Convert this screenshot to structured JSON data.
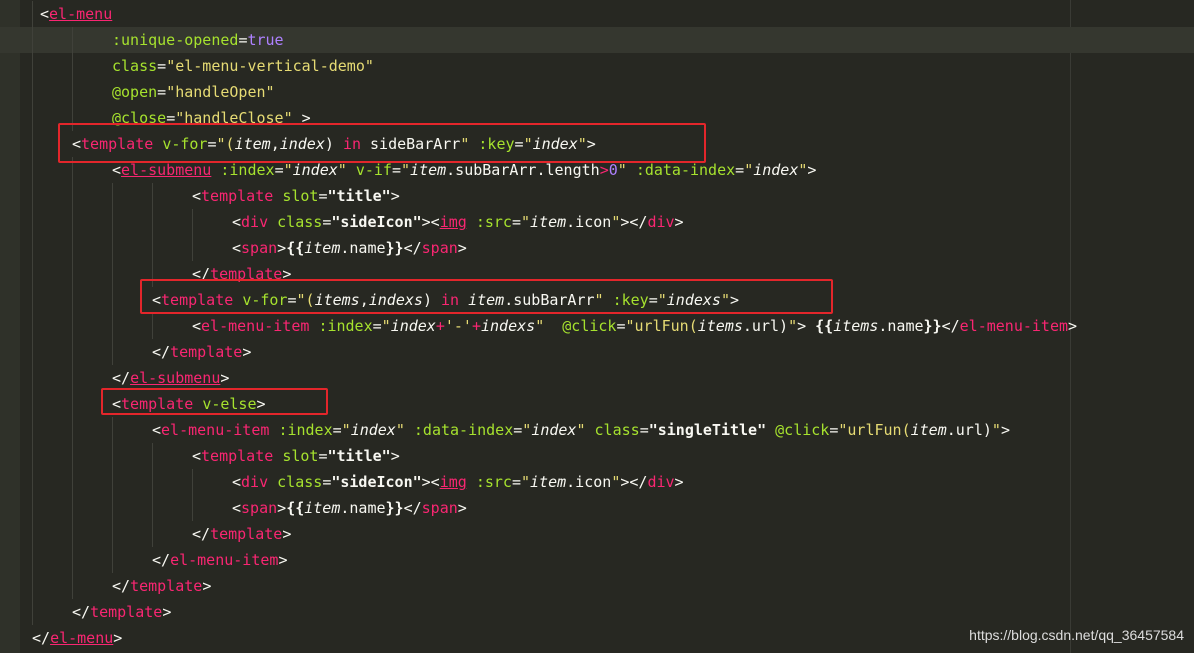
{
  "colors": {
    "background": "#272822",
    "highlight_box": "#e3262b",
    "tag": "#f92672",
    "attribute": "#a6e22e",
    "string": "#e6db74"
  },
  "code_lines": [
    [
      {
        "c": "p",
        "t": "<"
      },
      {
        "c": "t u",
        "t": "el-menu"
      }
    ],
    [
      {
        "c": "a",
        "t": ":unique-opened"
      },
      {
        "c": "p",
        "t": "="
      },
      {
        "c": "n",
        "t": "true"
      }
    ],
    [
      {
        "c": "a",
        "t": "class"
      },
      {
        "c": "p",
        "t": "="
      },
      {
        "c": "s",
        "t": "\"el-menu-vertical-demo\""
      }
    ],
    [
      {
        "c": "a",
        "t": "@open"
      },
      {
        "c": "p",
        "t": "="
      },
      {
        "c": "s",
        "t": "\"handleOpen\""
      }
    ],
    [
      {
        "c": "a",
        "t": "@close"
      },
      {
        "c": "p",
        "t": "="
      },
      {
        "c": "s",
        "t": "\"handleClose\""
      },
      {
        "c": "p",
        "t": " >"
      }
    ],
    [
      {
        "c": "p",
        "t": "<"
      },
      {
        "c": "t",
        "t": "template"
      },
      {
        "c": "p",
        "t": " "
      },
      {
        "c": "a",
        "t": "v-for"
      },
      {
        "c": "p",
        "t": "="
      },
      {
        "c": "s",
        "t": "\"("
      },
      {
        "c": "v",
        "t": "item"
      },
      {
        "c": "p",
        "t": ","
      },
      {
        "c": "v",
        "t": "index"
      },
      {
        "c": "p",
        "t": ") "
      },
      {
        "c": "k",
        "t": "in"
      },
      {
        "c": "p",
        "t": " sideBarArr"
      },
      {
        "c": "s",
        "t": "\""
      },
      {
        "c": "p",
        "t": " "
      },
      {
        "c": "a",
        "t": ":key"
      },
      {
        "c": "p",
        "t": "="
      },
      {
        "c": "s",
        "t": "\""
      },
      {
        "c": "v",
        "t": "index"
      },
      {
        "c": "s",
        "t": "\""
      },
      {
        "c": "p",
        "t": ">"
      }
    ],
    [
      {
        "c": "p",
        "t": "<"
      },
      {
        "c": "t u",
        "t": "el-submenu"
      },
      {
        "c": "p",
        "t": " "
      },
      {
        "c": "a",
        "t": ":index"
      },
      {
        "c": "p",
        "t": "="
      },
      {
        "c": "s",
        "t": "\""
      },
      {
        "c": "v",
        "t": "index"
      },
      {
        "c": "s",
        "t": "\""
      },
      {
        "c": "p",
        "t": " "
      },
      {
        "c": "a",
        "t": "v-if"
      },
      {
        "c": "p",
        "t": "="
      },
      {
        "c": "s",
        "t": "\""
      },
      {
        "c": "v",
        "t": "item"
      },
      {
        "c": "p",
        "t": ".subBarArr.length"
      },
      {
        "c": "k",
        "t": ">"
      },
      {
        "c": "n",
        "t": "0"
      },
      {
        "c": "s",
        "t": "\""
      },
      {
        "c": "p",
        "t": " "
      },
      {
        "c": "a",
        "t": ":data-index"
      },
      {
        "c": "p",
        "t": "="
      },
      {
        "c": "s",
        "t": "\""
      },
      {
        "c": "v",
        "t": "index"
      },
      {
        "c": "s",
        "t": "\""
      },
      {
        "c": "p",
        "t": ">"
      }
    ],
    [
      {
        "c": "p",
        "t": "<"
      },
      {
        "c": "t",
        "t": "template"
      },
      {
        "c": "p",
        "t": " "
      },
      {
        "c": "a",
        "t": "slot"
      },
      {
        "c": "p",
        "t": "="
      },
      {
        "c": "s b",
        "t": "\"title\""
      },
      {
        "c": "p",
        "t": ">"
      }
    ],
    [
      {
        "c": "p",
        "t": "<"
      },
      {
        "c": "t",
        "t": "div"
      },
      {
        "c": "p",
        "t": " "
      },
      {
        "c": "a",
        "t": "class"
      },
      {
        "c": "p",
        "t": "="
      },
      {
        "c": "s b",
        "t": "\"sideIcon\""
      },
      {
        "c": "p",
        "t": "><"
      },
      {
        "c": "t u",
        "t": "img"
      },
      {
        "c": "p",
        "t": " "
      },
      {
        "c": "a",
        "t": ":src"
      },
      {
        "c": "p",
        "t": "="
      },
      {
        "c": "s",
        "t": "\""
      },
      {
        "c": "v",
        "t": "item"
      },
      {
        "c": "p",
        "t": ".icon"
      },
      {
        "c": "s",
        "t": "\""
      },
      {
        "c": "p",
        "t": "></"
      },
      {
        "c": "t",
        "t": "div"
      },
      {
        "c": "p",
        "t": ">"
      }
    ],
    [
      {
        "c": "p",
        "t": "<"
      },
      {
        "c": "t",
        "t": "span"
      },
      {
        "c": "p",
        "t": ">"
      },
      {
        "c": "b",
        "t": "{{"
      },
      {
        "c": "v",
        "t": "item"
      },
      {
        "c": "p",
        "t": ".name"
      },
      {
        "c": "b",
        "t": "}}"
      },
      {
        "c": "p",
        "t": "</"
      },
      {
        "c": "t",
        "t": "span"
      },
      {
        "c": "p",
        "t": ">"
      }
    ],
    [
      {
        "c": "p",
        "t": "</"
      },
      {
        "c": "t",
        "t": "template"
      },
      {
        "c": "p",
        "t": ">"
      }
    ],
    [
      {
        "c": "p",
        "t": "<"
      },
      {
        "c": "t",
        "t": "template"
      },
      {
        "c": "p",
        "t": " "
      },
      {
        "c": "a",
        "t": "v-for"
      },
      {
        "c": "p",
        "t": "="
      },
      {
        "c": "s",
        "t": "\"("
      },
      {
        "c": "v",
        "t": "items"
      },
      {
        "c": "p",
        "t": ","
      },
      {
        "c": "v",
        "t": "indexs"
      },
      {
        "c": "p",
        "t": ") "
      },
      {
        "c": "k",
        "t": "in"
      },
      {
        "c": "p",
        "t": " "
      },
      {
        "c": "v",
        "t": "item"
      },
      {
        "c": "p",
        "t": ".subBarArr"
      },
      {
        "c": "s",
        "t": "\""
      },
      {
        "c": "p",
        "t": " "
      },
      {
        "c": "a",
        "t": ":key"
      },
      {
        "c": "p",
        "t": "="
      },
      {
        "c": "s",
        "t": "\""
      },
      {
        "c": "v",
        "t": "indexs"
      },
      {
        "c": "s",
        "t": "\""
      },
      {
        "c": "p",
        "t": ">"
      }
    ],
    [
      {
        "c": "p",
        "t": "<"
      },
      {
        "c": "t",
        "t": "el-menu-item"
      },
      {
        "c": "p",
        "t": " "
      },
      {
        "c": "a",
        "t": ":index"
      },
      {
        "c": "p",
        "t": "="
      },
      {
        "c": "s",
        "t": "\""
      },
      {
        "c": "v",
        "t": "index"
      },
      {
        "c": "k",
        "t": "+"
      },
      {
        "c": "s",
        "t": "'-'"
      },
      {
        "c": "k",
        "t": "+"
      },
      {
        "c": "v",
        "t": "indexs"
      },
      {
        "c": "s",
        "t": "\""
      },
      {
        "c": "p",
        "t": "  "
      },
      {
        "c": "a",
        "t": "@click"
      },
      {
        "c": "p",
        "t": "="
      },
      {
        "c": "s",
        "t": "\"urlFun("
      },
      {
        "c": "v",
        "t": "items"
      },
      {
        "c": "p",
        "t": ".url)"
      },
      {
        "c": "s",
        "t": "\""
      },
      {
        "c": "p",
        "t": "> "
      },
      {
        "c": "b",
        "t": "{{"
      },
      {
        "c": "v",
        "t": "items"
      },
      {
        "c": "p",
        "t": ".name"
      },
      {
        "c": "b",
        "t": "}}"
      },
      {
        "c": "p",
        "t": "</"
      },
      {
        "c": "t",
        "t": "el-menu-item"
      },
      {
        "c": "p",
        "t": ">"
      }
    ],
    [
      {
        "c": "p",
        "t": "</"
      },
      {
        "c": "t",
        "t": "template"
      },
      {
        "c": "p",
        "t": ">"
      }
    ],
    [
      {
        "c": "p",
        "t": "</"
      },
      {
        "c": "t u",
        "t": "el-submenu"
      },
      {
        "c": "p",
        "t": ">"
      }
    ],
    [
      {
        "c": "p",
        "t": "<"
      },
      {
        "c": "t",
        "t": "template"
      },
      {
        "c": "p",
        "t": " "
      },
      {
        "c": "a",
        "t": "v-else"
      },
      {
        "c": "p",
        "t": ">"
      }
    ],
    [
      {
        "c": "p",
        "t": "<"
      },
      {
        "c": "t",
        "t": "el-menu-item"
      },
      {
        "c": "p",
        "t": " "
      },
      {
        "c": "a",
        "t": ":index"
      },
      {
        "c": "p",
        "t": "="
      },
      {
        "c": "s",
        "t": "\""
      },
      {
        "c": "v",
        "t": "index"
      },
      {
        "c": "s",
        "t": "\""
      },
      {
        "c": "p",
        "t": " "
      },
      {
        "c": "a",
        "t": ":data-index"
      },
      {
        "c": "p",
        "t": "="
      },
      {
        "c": "s",
        "t": "\""
      },
      {
        "c": "v",
        "t": "index"
      },
      {
        "c": "s",
        "t": "\""
      },
      {
        "c": "p",
        "t": " "
      },
      {
        "c": "a",
        "t": "class"
      },
      {
        "c": "p",
        "t": "="
      },
      {
        "c": "s b",
        "t": "\"singleTitle\""
      },
      {
        "c": "p",
        "t": " "
      },
      {
        "c": "a",
        "t": "@click"
      },
      {
        "c": "p",
        "t": "="
      },
      {
        "c": "s",
        "t": "\"urlFun("
      },
      {
        "c": "v",
        "t": "item"
      },
      {
        "c": "p",
        "t": ".url)"
      },
      {
        "c": "s",
        "t": "\""
      },
      {
        "c": "p",
        "t": ">"
      }
    ],
    [
      {
        "c": "p",
        "t": "<"
      },
      {
        "c": "t",
        "t": "template"
      },
      {
        "c": "p",
        "t": " "
      },
      {
        "c": "a",
        "t": "slot"
      },
      {
        "c": "p",
        "t": "="
      },
      {
        "c": "s b",
        "t": "\"title\""
      },
      {
        "c": "p",
        "t": ">"
      }
    ],
    [
      {
        "c": "p",
        "t": "<"
      },
      {
        "c": "t",
        "t": "div"
      },
      {
        "c": "p",
        "t": " "
      },
      {
        "c": "a",
        "t": "class"
      },
      {
        "c": "p",
        "t": "="
      },
      {
        "c": "s b",
        "t": "\"sideIcon\""
      },
      {
        "c": "p",
        "t": "><"
      },
      {
        "c": "t u",
        "t": "img"
      },
      {
        "c": "p",
        "t": " "
      },
      {
        "c": "a",
        "t": ":src"
      },
      {
        "c": "p",
        "t": "="
      },
      {
        "c": "s",
        "t": "\""
      },
      {
        "c": "v",
        "t": "item"
      },
      {
        "c": "p",
        "t": ".icon"
      },
      {
        "c": "s",
        "t": "\""
      },
      {
        "c": "p",
        "t": "></"
      },
      {
        "c": "t",
        "t": "div"
      },
      {
        "c": "p",
        "t": ">"
      }
    ],
    [
      {
        "c": "p",
        "t": "<"
      },
      {
        "c": "t",
        "t": "span"
      },
      {
        "c": "p",
        "t": ">"
      },
      {
        "c": "b",
        "t": "{{"
      },
      {
        "c": "v",
        "t": "item"
      },
      {
        "c": "p",
        "t": ".name"
      },
      {
        "c": "b",
        "t": "}}"
      },
      {
        "c": "p",
        "t": "</"
      },
      {
        "c": "t",
        "t": "span"
      },
      {
        "c": "p",
        "t": ">"
      }
    ],
    [
      {
        "c": "p",
        "t": "</"
      },
      {
        "c": "t",
        "t": "template"
      },
      {
        "c": "p",
        "t": ">"
      }
    ],
    [
      {
        "c": "p",
        "t": "</"
      },
      {
        "c": "t",
        "t": "el-menu-item"
      },
      {
        "c": "p",
        "t": ">"
      }
    ],
    [
      {
        "c": "p",
        "t": "</"
      },
      {
        "c": "t",
        "t": "template"
      },
      {
        "c": "p",
        "t": ">"
      }
    ],
    [
      {
        "c": "p",
        "t": "</"
      },
      {
        "c": "t",
        "t": "template"
      },
      {
        "c": "p",
        "t": ">"
      }
    ],
    [
      {
        "c": "p",
        "t": "</"
      },
      {
        "c": "t u",
        "t": "el-menu"
      },
      {
        "c": "p",
        "t": ">"
      }
    ]
  ],
  "watermark": "https://blog.csdn.net/qq_36457584"
}
